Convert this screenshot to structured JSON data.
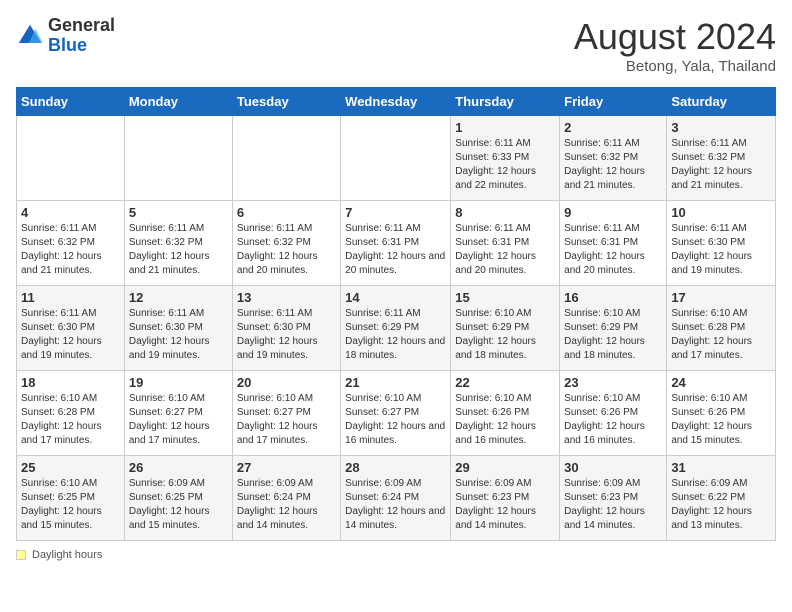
{
  "header": {
    "logo_general": "General",
    "logo_blue": "Blue",
    "title": "August 2024",
    "location": "Betong, Yala, Thailand"
  },
  "weekdays": [
    "Sunday",
    "Monday",
    "Tuesday",
    "Wednesday",
    "Thursday",
    "Friday",
    "Saturday"
  ],
  "footer": {
    "label": "Daylight hours"
  },
  "weeks": [
    [
      {
        "day": "",
        "info": ""
      },
      {
        "day": "",
        "info": ""
      },
      {
        "day": "",
        "info": ""
      },
      {
        "day": "",
        "info": ""
      },
      {
        "day": "1",
        "info": "Sunrise: 6:11 AM\nSunset: 6:33 PM\nDaylight: 12 hours and 22 minutes."
      },
      {
        "day": "2",
        "info": "Sunrise: 6:11 AM\nSunset: 6:32 PM\nDaylight: 12 hours and 21 minutes."
      },
      {
        "day": "3",
        "info": "Sunrise: 6:11 AM\nSunset: 6:32 PM\nDaylight: 12 hours and 21 minutes."
      }
    ],
    [
      {
        "day": "4",
        "info": "Sunrise: 6:11 AM\nSunset: 6:32 PM\nDaylight: 12 hours and 21 minutes."
      },
      {
        "day": "5",
        "info": "Sunrise: 6:11 AM\nSunset: 6:32 PM\nDaylight: 12 hours and 21 minutes."
      },
      {
        "day": "6",
        "info": "Sunrise: 6:11 AM\nSunset: 6:32 PM\nDaylight: 12 hours and 20 minutes."
      },
      {
        "day": "7",
        "info": "Sunrise: 6:11 AM\nSunset: 6:31 PM\nDaylight: 12 hours and 20 minutes."
      },
      {
        "day": "8",
        "info": "Sunrise: 6:11 AM\nSunset: 6:31 PM\nDaylight: 12 hours and 20 minutes."
      },
      {
        "day": "9",
        "info": "Sunrise: 6:11 AM\nSunset: 6:31 PM\nDaylight: 12 hours and 20 minutes."
      },
      {
        "day": "10",
        "info": "Sunrise: 6:11 AM\nSunset: 6:30 PM\nDaylight: 12 hours and 19 minutes."
      }
    ],
    [
      {
        "day": "11",
        "info": "Sunrise: 6:11 AM\nSunset: 6:30 PM\nDaylight: 12 hours and 19 minutes."
      },
      {
        "day": "12",
        "info": "Sunrise: 6:11 AM\nSunset: 6:30 PM\nDaylight: 12 hours and 19 minutes."
      },
      {
        "day": "13",
        "info": "Sunrise: 6:11 AM\nSunset: 6:30 PM\nDaylight: 12 hours and 19 minutes."
      },
      {
        "day": "14",
        "info": "Sunrise: 6:11 AM\nSunset: 6:29 PM\nDaylight: 12 hours and 18 minutes."
      },
      {
        "day": "15",
        "info": "Sunrise: 6:10 AM\nSunset: 6:29 PM\nDaylight: 12 hours and 18 minutes."
      },
      {
        "day": "16",
        "info": "Sunrise: 6:10 AM\nSunset: 6:29 PM\nDaylight: 12 hours and 18 minutes."
      },
      {
        "day": "17",
        "info": "Sunrise: 6:10 AM\nSunset: 6:28 PM\nDaylight: 12 hours and 17 minutes."
      }
    ],
    [
      {
        "day": "18",
        "info": "Sunrise: 6:10 AM\nSunset: 6:28 PM\nDaylight: 12 hours and 17 minutes."
      },
      {
        "day": "19",
        "info": "Sunrise: 6:10 AM\nSunset: 6:27 PM\nDaylight: 12 hours and 17 minutes."
      },
      {
        "day": "20",
        "info": "Sunrise: 6:10 AM\nSunset: 6:27 PM\nDaylight: 12 hours and 17 minutes."
      },
      {
        "day": "21",
        "info": "Sunrise: 6:10 AM\nSunset: 6:27 PM\nDaylight: 12 hours and 16 minutes."
      },
      {
        "day": "22",
        "info": "Sunrise: 6:10 AM\nSunset: 6:26 PM\nDaylight: 12 hours and 16 minutes."
      },
      {
        "day": "23",
        "info": "Sunrise: 6:10 AM\nSunset: 6:26 PM\nDaylight: 12 hours and 16 minutes."
      },
      {
        "day": "24",
        "info": "Sunrise: 6:10 AM\nSunset: 6:26 PM\nDaylight: 12 hours and 15 minutes."
      }
    ],
    [
      {
        "day": "25",
        "info": "Sunrise: 6:10 AM\nSunset: 6:25 PM\nDaylight: 12 hours and 15 minutes."
      },
      {
        "day": "26",
        "info": "Sunrise: 6:09 AM\nSunset: 6:25 PM\nDaylight: 12 hours and 15 minutes."
      },
      {
        "day": "27",
        "info": "Sunrise: 6:09 AM\nSunset: 6:24 PM\nDaylight: 12 hours and 14 minutes."
      },
      {
        "day": "28",
        "info": "Sunrise: 6:09 AM\nSunset: 6:24 PM\nDaylight: 12 hours and 14 minutes."
      },
      {
        "day": "29",
        "info": "Sunrise: 6:09 AM\nSunset: 6:23 PM\nDaylight: 12 hours and 14 minutes."
      },
      {
        "day": "30",
        "info": "Sunrise: 6:09 AM\nSunset: 6:23 PM\nDaylight: 12 hours and 14 minutes."
      },
      {
        "day": "31",
        "info": "Sunrise: 6:09 AM\nSunset: 6:22 PM\nDaylight: 12 hours and 13 minutes."
      }
    ]
  ]
}
